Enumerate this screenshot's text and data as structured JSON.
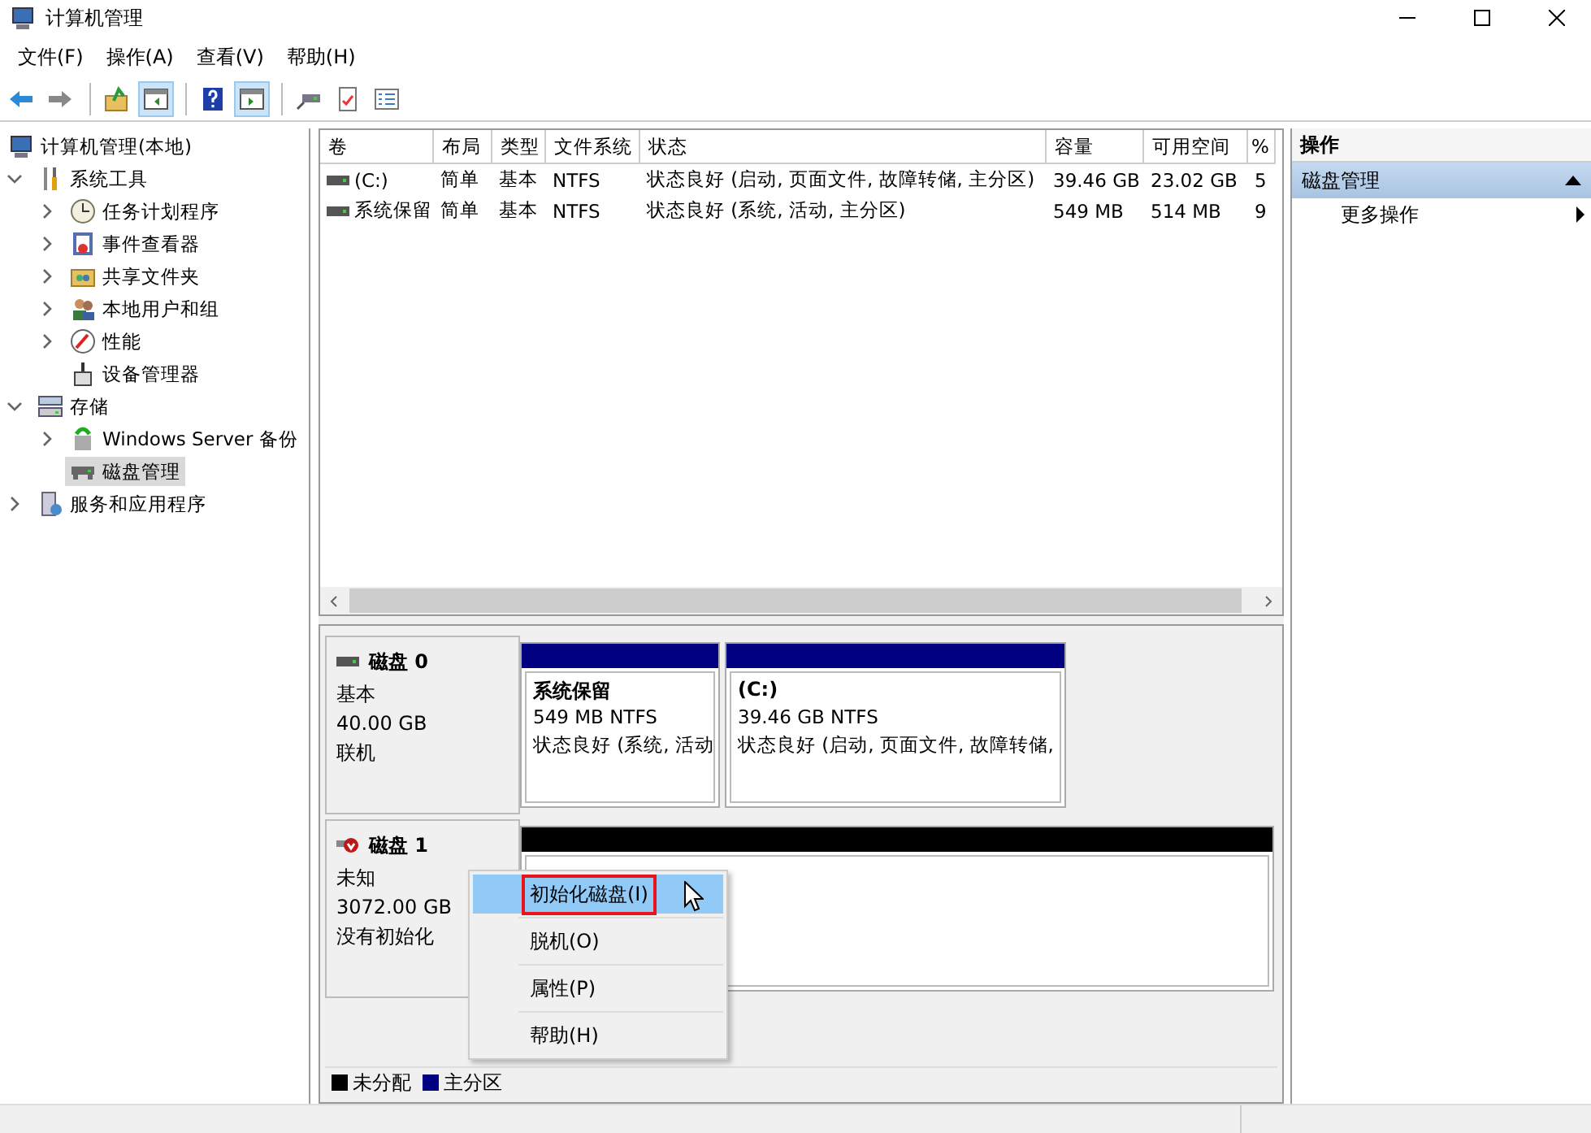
{
  "window": {
    "title": "计算机管理"
  },
  "menu": [
    "文件(F)",
    "操作(A)",
    "查看(V)",
    "帮助(H)"
  ],
  "toolbar": [
    {
      "kind": "back",
      "pressed": false
    },
    {
      "kind": "forward",
      "pressed": false
    },
    {
      "kind": "separator"
    },
    {
      "kind": "up",
      "pressed": false
    },
    {
      "kind": "tree",
      "pressed": true
    },
    {
      "kind": "separator"
    },
    {
      "kind": "help",
      "pressed": false
    },
    {
      "kind": "actions",
      "pressed": true
    },
    {
      "kind": "separator"
    },
    {
      "kind": "connect",
      "pressed": false
    },
    {
      "kind": "check",
      "pressed": false
    },
    {
      "kind": "list",
      "pressed": false
    }
  ],
  "tree": [
    {
      "label": "计算机管理(本地)",
      "kind": "computer",
      "selected": false,
      "children": [
        {
          "label": "系统工具",
          "kind": "tools",
          "expanded": true,
          "selected": false,
          "children": [
            {
              "label": "任务计划程序",
              "kind": "clock",
              "expanded": false,
              "selected": false
            },
            {
              "label": "事件查看器",
              "kind": "log",
              "expanded": false,
              "selected": false
            },
            {
              "label": "共享文件夹",
              "kind": "folder",
              "expanded": false,
              "selected": false
            },
            {
              "label": "本地用户和组",
              "kind": "users",
              "expanded": false,
              "selected": false
            },
            {
              "label": "性能",
              "kind": "gauge",
              "expanded": false,
              "selected": false
            },
            {
              "label": "设备管理器",
              "kind": "device",
              "selected": false
            }
          ]
        },
        {
          "label": "存储",
          "kind": "storage",
          "expanded": true,
          "selected": false,
          "children": [
            {
              "label": "Windows Server 备份",
              "kind": "backup",
              "expanded": false,
              "selected": false
            },
            {
              "label": "磁盘管理",
              "kind": "drive",
              "selected": true
            }
          ]
        },
        {
          "label": "服务和应用程序",
          "kind": "server",
          "expanded": false,
          "selected": false
        }
      ]
    }
  ],
  "volumes": {
    "columns": [
      "卷",
      "布局",
      "类型",
      "文件系统",
      "状态",
      "容量",
      "可用空间",
      "%"
    ],
    "rows": [
      {
        "cells": [
          "(C:)",
          "简单",
          "基本",
          "NTFS",
          "状态良好 (启动, 页面文件, 故障转储, 主分区)",
          "39.46 GB",
          "23.02 GB",
          "5"
        ]
      },
      {
        "cells": [
          "系统保留",
          "简单",
          "基本",
          "NTFS",
          "状态良好 (系统, 活动, 主分区)",
          "549 MB",
          "514 MB",
          "9"
        ]
      }
    ]
  },
  "disks": [
    {
      "name": "磁盘 0",
      "kind": "online",
      "info": [
        "基本",
        "40.00 GB",
        "联机"
      ],
      "partitions": [
        {
          "name": "系统保留",
          "size": "549 MB NTFS",
          "status": "状态良好 (系统, 活动",
          "color": "#000080"
        },
        {
          "name": "(C:)",
          "size": "39.46 GB NTFS",
          "status": "状态良好 (启动, 页面文件, 故障转储,",
          "color": "#000080"
        }
      ]
    },
    {
      "name": "磁盘 1",
      "kind": "error",
      "info": [
        "未知",
        "3072.00 GB",
        "没有初始化"
      ],
      "partitions": [
        {
          "color": "#000000"
        }
      ]
    }
  ],
  "context_menu": [
    {
      "label": "初始化磁盘(I)",
      "selected": true,
      "outlined": true
    },
    {
      "label": "脱机(O)",
      "selected": false,
      "outlined": false
    },
    {
      "label": "属性(P)",
      "selected": false,
      "outlined": false
    },
    {
      "label": "帮助(H)",
      "selected": false,
      "outlined": false
    }
  ],
  "legend": [
    {
      "label": "未分配",
      "color": "#000000"
    },
    {
      "label": "主分区",
      "color": "#000080"
    }
  ],
  "actions": {
    "title": "操作",
    "sections": [
      {
        "label": "磁盘管理",
        "expanded": true,
        "items": [
          {
            "label": "更多操作"
          }
        ]
      }
    ]
  }
}
